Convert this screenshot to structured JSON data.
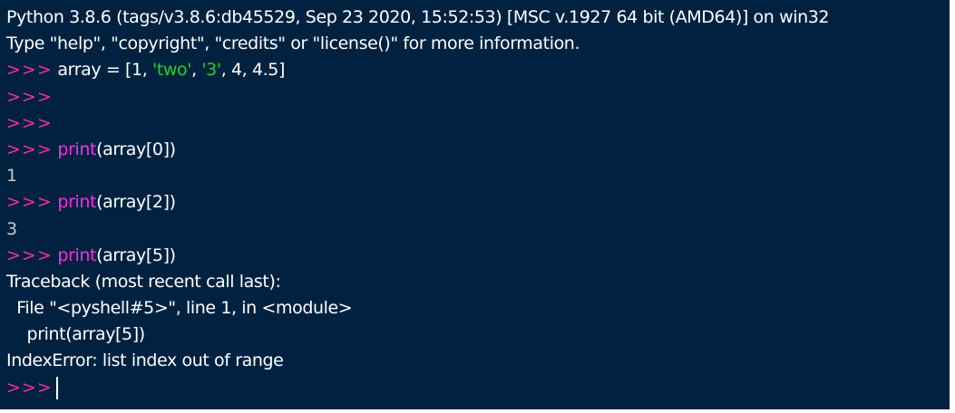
{
  "colors": {
    "background": "#002240",
    "prompt": "#ff2a9a",
    "string": "#27d027",
    "builtin": "#ff2ce0",
    "text": "#ffffff",
    "output": "#c8c8c8"
  },
  "banner": {
    "line1": "Python 3.8.6 (tags/v3.8.6:db45529, Sep 23 2020, 15:52:53) [MSC v.1927 64 bit (AMD64)] on win32",
    "line2": "Type \"help\", \"copyright\", \"credits\" or \"license()\" for more information."
  },
  "prompt": ">>>",
  "assignment": {
    "lead": " array = [1, ",
    "str1": "'two'",
    "sep1": ", ",
    "str2": "'3'",
    "tail": ", 4, 4.5]"
  },
  "calls": [
    {
      "builtin": "print",
      "args": "(array[0])",
      "output": "1"
    },
    {
      "builtin": "print",
      "args": "(array[2])",
      "output": "3"
    },
    {
      "builtin": "print",
      "args": "(array[5])"
    }
  ],
  "traceback": {
    "header": "Traceback (most recent call last):",
    "file_line": "  File \"<pyshell#5>\", line 1, in <module>",
    "code_line": "    print(array[5])",
    "error": "IndexError: list index out of range"
  }
}
